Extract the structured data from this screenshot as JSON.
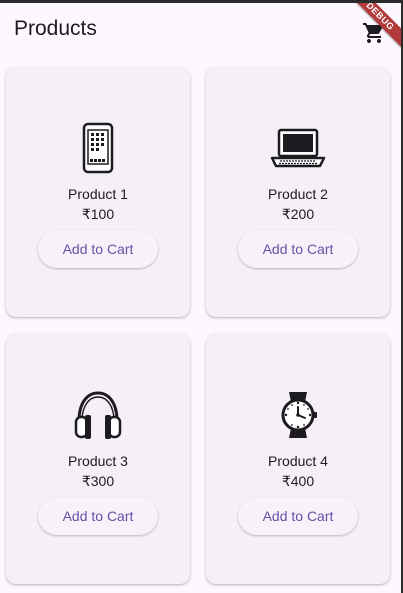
{
  "appbar": {
    "title": "Products",
    "cart_icon": "shopping-cart-icon",
    "debug_banner": "DEBUG"
  },
  "products": [
    {
      "name": "Product 1",
      "price": "₹100",
      "icon": "smartphone-icon",
      "button_label": "Add to Cart"
    },
    {
      "name": "Product 2",
      "price": "₹200",
      "icon": "laptop-icon",
      "button_label": "Add to Cart"
    },
    {
      "name": "Product 3",
      "price": "₹300",
      "icon": "headphones-icon",
      "button_label": "Add to Cart"
    },
    {
      "name": "Product 4",
      "price": "₹400",
      "icon": "watch-icon",
      "button_label": "Add to Cart"
    }
  ],
  "colors": {
    "background": "#fdf7ff",
    "card": "#f5eff7",
    "accent": "#6750a4",
    "debug_banner": "#b13a3a"
  }
}
